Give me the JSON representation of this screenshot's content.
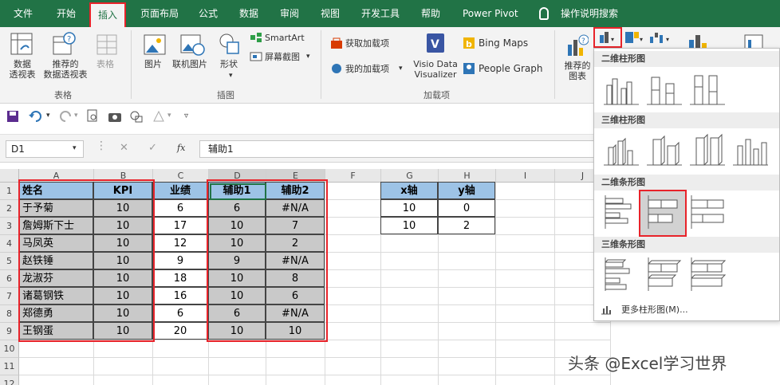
{
  "ribbon_tabs": [
    "文件",
    "开始",
    "插入",
    "页面布局",
    "公式",
    "数据",
    "审阅",
    "视图",
    "开发工具",
    "帮助",
    "Power Pivot",
    "操作说明搜索"
  ],
  "active_tab": "插入",
  "ribbon": {
    "pivot_table": [
      "数据",
      "透视表"
    ],
    "recommended_pivot": [
      "推荐的",
      "数据透视表"
    ],
    "table": "表格",
    "group_tables": "表格",
    "picture": "图片",
    "online_picture": "联机图片",
    "shapes": "形状",
    "smartart": "SmartArt",
    "screenshot": "屏幕截图",
    "group_illustrations": "插图",
    "get_addins": "获取加载项",
    "my_addins": "我的加载项",
    "visio": [
      "Visio Data",
      "Visualizer"
    ],
    "bing_maps": "Bing Maps",
    "people_graph": "People Graph",
    "group_addins": "加载项",
    "recommended_charts": [
      "推荐的",
      "图表"
    ]
  },
  "formula_bar": {
    "name_box": "D1",
    "fx": "fx",
    "content": "辅助1"
  },
  "columns": [
    "A",
    "B",
    "C",
    "D",
    "E",
    "F",
    "G",
    "H",
    "I",
    "J"
  ],
  "rows": [
    "1",
    "2",
    "3",
    "4",
    "5",
    "6",
    "7",
    "8",
    "9",
    "10",
    "11",
    "12"
  ],
  "table_main": {
    "headers": [
      "姓名",
      "KPI",
      "业绩",
      "辅助1",
      "辅助2"
    ],
    "rows": [
      [
        "于予菊",
        "10",
        "6",
        "6",
        "#N/A"
      ],
      [
        "詹姆斯下士",
        "10",
        "17",
        "10",
        "7"
      ],
      [
        "马凤英",
        "10",
        "12",
        "10",
        "2"
      ],
      [
        "赵铁锤",
        "10",
        "9",
        "9",
        "#N/A"
      ],
      [
        "龙淑芬",
        "10",
        "18",
        "10",
        "8"
      ],
      [
        "诸葛钢铁",
        "10",
        "16",
        "10",
        "6"
      ],
      [
        "郑德勇",
        "10",
        "6",
        "6",
        "#N/A"
      ],
      [
        "王钢蛋",
        "10",
        "20",
        "10",
        "10"
      ]
    ]
  },
  "table_axis": {
    "headers": [
      "x轴",
      "y轴"
    ],
    "rows": [
      [
        "10",
        "0"
      ],
      [
        "10",
        "2"
      ]
    ]
  },
  "dropdown": {
    "sections": [
      "二维柱形图",
      "三维柱形图",
      "二维条形图",
      "三维条形图"
    ],
    "more": "更多柱形图(M)..."
  },
  "watermark": "头条 @Excel学习世界",
  "colors": {
    "excel_green": "#217346",
    "header_blue": "#9dc3e6",
    "gray_fill": "#c9c9c9",
    "highlight_red": "#e8232a"
  }
}
